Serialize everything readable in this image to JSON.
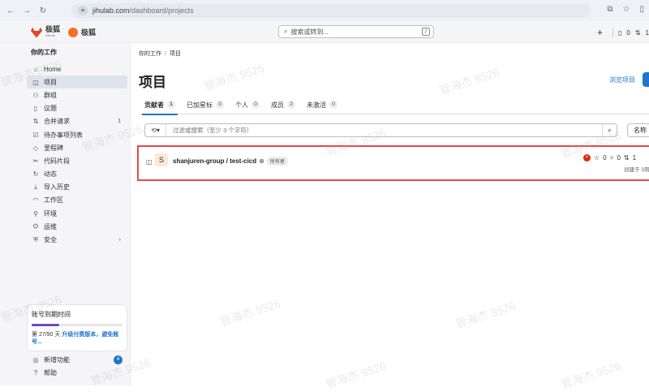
{
  "browser": {
    "url_host": "jihulab.com",
    "url_path": "/dashboard/projects"
  },
  "header": {
    "brand_name": "极狐",
    "brand_sub": "GitLab",
    "brand2_name": "极狐",
    "search_placeholder": "搜索或转到...",
    "search_shortcut": "/",
    "plus": "+",
    "issues_count": "0",
    "mr_count": "1"
  },
  "sidebar": {
    "title": "你的工作",
    "items": [
      {
        "label": "Home",
        "icon": "home-icon",
        "count": ""
      },
      {
        "label": "项目",
        "icon": "project-icon",
        "count": ""
      },
      {
        "label": "群组",
        "icon": "group-icon",
        "count": ""
      },
      {
        "label": "议题",
        "icon": "issues-icon",
        "count": ""
      },
      {
        "label": "合并请求",
        "icon": "merge-request-icon",
        "count": "1"
      },
      {
        "label": "待办事项列表",
        "icon": "todo-icon",
        "count": ""
      },
      {
        "label": "里程碑",
        "icon": "milestone-icon",
        "count": ""
      },
      {
        "label": "代码片段",
        "icon": "snippet-icon",
        "count": ""
      },
      {
        "label": "动态",
        "icon": "activity-icon",
        "count": ""
      },
      {
        "label": "导入历史",
        "icon": "import-icon",
        "count": ""
      },
      {
        "label": "工作区",
        "icon": "workspace-icon",
        "count": ""
      },
      {
        "label": "环境",
        "icon": "environment-icon",
        "count": ""
      },
      {
        "label": "运维",
        "icon": "operations-icon",
        "count": ""
      },
      {
        "label": "安全",
        "icon": "security-icon",
        "count": ""
      }
    ],
    "trial": {
      "title": "账号到期时间",
      "progress_fraction": 0.3,
      "days_text": "第 27/90 天",
      "upgrade_link": "升级付费版本，避免账号..."
    },
    "footer": [
      {
        "label": "新增功能",
        "badge": "4"
      },
      {
        "label": "帮助",
        "badge": ""
      }
    ]
  },
  "main": {
    "breadcrumb": [
      "你的工作",
      "项目"
    ],
    "breadcrumb_sep": "/",
    "title": "项目",
    "browse_label": "浏览项目",
    "tabs": [
      {
        "label": "贡献者",
        "count": "1"
      },
      {
        "label": "已加星标",
        "count": "0"
      },
      {
        "label": "个人",
        "count": "0"
      },
      {
        "label": "成员",
        "count": "2"
      },
      {
        "label": "未激活",
        "count": "0"
      }
    ],
    "filter_placeholder": "过滤或搜索（至少 3 个字符）",
    "sort_label": "名称",
    "project": {
      "avatar_letter": "S",
      "name": "shanjuren-group / test-cicd",
      "role": "所有者",
      "stars": "0",
      "forks": "0",
      "mrs": "1",
      "created": "创建于 3周"
    }
  },
  "watermark": "管海杰 9526",
  "colors": {
    "accent": "#1f75cb",
    "highlight_border": "#e5484d",
    "pipeline_failed": "#dd2b0e"
  }
}
